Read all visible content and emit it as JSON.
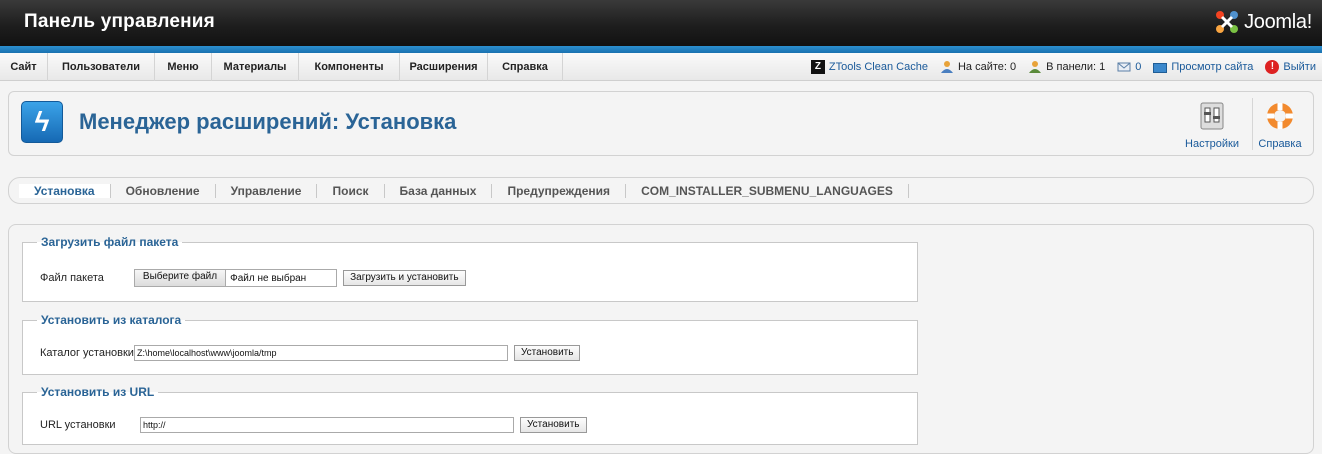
{
  "header": {
    "title": "Панель управления",
    "logo_text": "Joomla!"
  },
  "menu": {
    "items": [
      "Сайт",
      "Пользователи",
      "Меню",
      "Материалы",
      "Компоненты",
      "Расширения",
      "Справка"
    ]
  },
  "status": {
    "ztools": "ZTools Clean Cache",
    "on_site": "На сайте: 0",
    "in_panel": "В панели: 1",
    "messages": "0",
    "preview": "Просмотр сайта",
    "logout": "Выйти"
  },
  "toolbar": {
    "page_title": "Менеджер расширений: Установка",
    "settings_label": "Настройки",
    "help_label": "Справка"
  },
  "submenu": {
    "items": [
      "Установка",
      "Обновление",
      "Управление",
      "Поиск",
      "База данных",
      "Предупреждения",
      "COM_INSTALLER_SUBMENU_LANGUAGES"
    ],
    "active_index": 0
  },
  "upload": {
    "legend": "Загрузить файл пакета",
    "label": "Файл пакета",
    "choose_button": "Выберите файл",
    "file_name": "Файл не выбран",
    "submit": "Загрузить и установить"
  },
  "directory": {
    "legend": "Установить из каталога",
    "label": "Каталог установки",
    "value": "Z:\\home\\localhost\\www\\joomla/tmp",
    "submit": "Установить"
  },
  "url": {
    "legend": "Установить из URL",
    "label": "URL установки",
    "value": "http://",
    "submit": "Установить"
  },
  "colors": {
    "accent_blue": "#2a6496",
    "header_bg": "#1e1e1e",
    "bluebar": "#1a72b0"
  }
}
